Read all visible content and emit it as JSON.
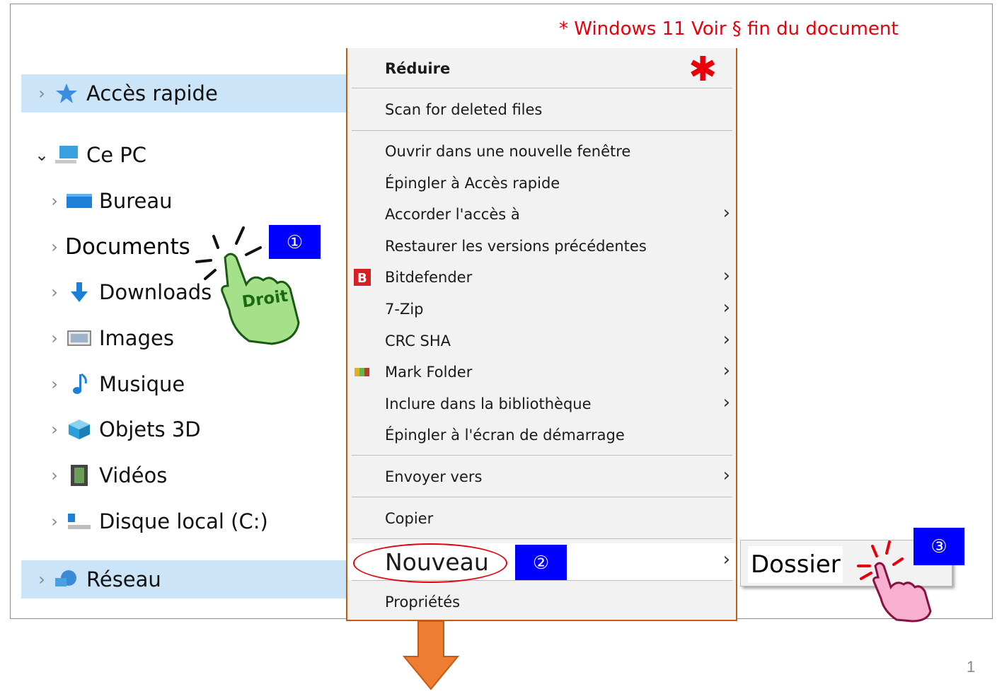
{
  "note": "* Windows 11 Voir § fin du document",
  "sidebar": {
    "quick_access": "Accès rapide",
    "this_pc": "Ce PC",
    "items": [
      "Bureau",
      "Documents",
      "Downloads",
      "Images",
      "Musique",
      "Objets 3D",
      "Vidéos",
      "Disque local (C:)"
    ],
    "network": "Réseau"
  },
  "hand1_label": "Droit",
  "badges": [
    "①",
    "②",
    "③"
  ],
  "menu": {
    "reduce": "Réduire",
    "scan": "Scan for deleted files",
    "open_new": "Ouvrir dans une nouvelle fenêtre",
    "pin_quick": "Épingler à Accès rapide",
    "grant": "Accorder l'accès à",
    "restore": "Restaurer les versions précédentes",
    "bitdefender": "Bitdefender",
    "zip": "7-Zip",
    "crc": "CRC SHA",
    "mark": "Mark Folder",
    "include": "Inclure dans la bibliothèque",
    "pin_start": "Épingler à l'écran de démarrage",
    "send": "Envoyer vers",
    "copy": "Copier",
    "new": "Nouveau",
    "props": "Propriétés"
  },
  "submenu": {
    "folder": "Dossier"
  },
  "page_number": "1",
  "colors": {
    "accent_red": "#e8000b",
    "badge_blue": "#0000ff",
    "selection": "#cce4f7",
    "menu_border": "#c55a11"
  }
}
